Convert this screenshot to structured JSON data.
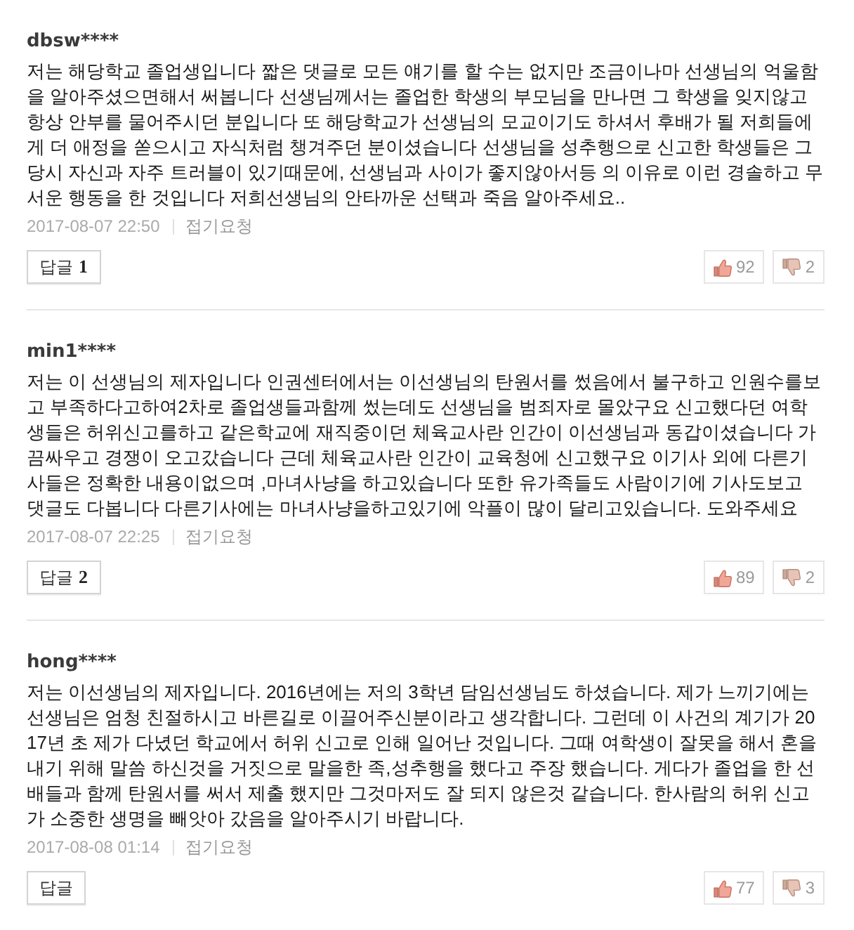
{
  "comments": [
    {
      "user": "dbsw****",
      "body": "저는 해당학교 졸업생입니다 짧은 댓글로 모든 얘기를 할 수는 없지만 조금이나마 선생님의 억울함을 알아주셨으면해서 써봅니다 선생님께서는 졸업한 학생의 부모님을 만나면 그 학생을 잊지않고 항상 안부를 물어주시던 분입니다 또 해당학교가 선생님의 모교이기도 하셔서 후배가 될 저희들에게 더 애정을 쏟으시고 자식처럼 챙겨주던 분이셨습니다 선생님을 성추행으로 신고한 학생들은 그 당시 자신과 자주 트러블이 있기때문에, 선생님과 사이가 좋지않아서등 의 이유로 이런 경솔하고 무서운 행동을 한 것입니다 저희선생님의 안타까운 선택과 죽음 알아주세요..",
      "date": "2017-08-07 22:50",
      "report": "접기요청",
      "reply": {
        "label": "답글",
        "count": "1"
      },
      "likes": "92",
      "dislikes": "2"
    },
    {
      "user": "min1****",
      "body": "저는 이 선생님의 제자입니다 인권센터에서는 이선생님의 탄원서를 썼음에서 불구하고 인원수를보고 부족하다고하여2차로 졸업생들과함께 썼는데도 선생님을 범죄자로 몰았구요 신고했다던 여학생들은 허위신고를하고 같은학교에 재직중이던 체육교사란 인간이 이선생님과 동갑이셨습니다 가끔싸우고 경쟁이 오고갔습니다 근데 체육교사란 인간이 교육청에 신고했구요 이기사 외에 다른기사들은 정확한 내용이없으며 ,마녀사냥을 하고있습니다 또한 유가족들도 사람이기에 기사도보고 댓글도 다봅니다 다른기사에는 마녀사냥을하고있기에 악플이 많이 달리고있습니다. 도와주세요",
      "date": "2017-08-07 22:25",
      "report": "접기요청",
      "reply": {
        "label": "답글",
        "count": "2"
      },
      "likes": "89",
      "dislikes": "2"
    },
    {
      "user": "hong****",
      "body": "저는 이선생님의 제자입니다. 2016년에는 저의 3학년 담임선생님도 하셨습니다. 제가 느끼기에는 선생님은 엄청 친절하시고 바른길로 이끌어주신분이라고 생각합니다. 그런데 이 사건의 계기가 2017년 초 제가 다녔던 학교에서 허위 신고로 인해 일어난 것입니다. 그때 여학생이 잘못을 해서 혼을 내기 위해 말씀 하신것을 거짓으로 말을한 족,성추행을 했다고 주장 했습니다. 게다가 졸업을 한 선배들과 함께 탄원서를 써서 제출 했지만 그것마저도 잘 되지 않은것 같습니다. 한사람의 허위 신고가 소중한 생명을 빼앗아 갔음을 알아주시기 바랍니다.",
      "date": "2017-08-08 01:14",
      "report": "접기요청",
      "reply": {
        "label": "답글"
      },
      "likes": "77",
      "dislikes": "3"
    }
  ]
}
